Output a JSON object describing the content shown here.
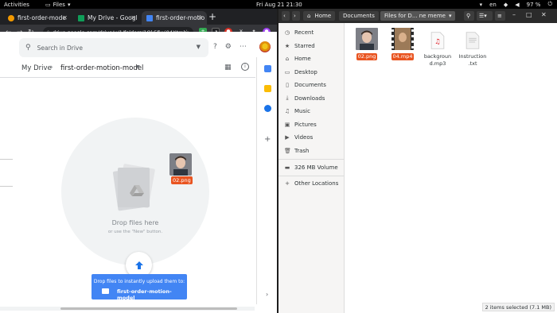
{
  "topbar": {
    "activities": "Activities",
    "app_menu": "Files",
    "clock": "Fri Aug 21  21:30",
    "lang": "en",
    "battery": "97 %"
  },
  "chrome": {
    "tabs": [
      {
        "title": "first-order-mode",
        "fav_color": "#f29900"
      },
      {
        "title": "My Drive - Googl",
        "fav_color": "#0f9d58"
      },
      {
        "title": "first-order-motio",
        "fav_color": "#4285f4"
      }
    ],
    "url": "drive.google.com/drive/u/1/folders/1Qk5fiwj04Xtmk..."
  },
  "drive": {
    "search_placeholder": "Search in Drive",
    "breadcrumb_root": "My Drive",
    "breadcrumb_folder": "first-order-motion-model",
    "drop_title": "Drop files here",
    "drop_sub": "or use the \"New\" button.",
    "toast_line1": "Drop files to instantly upload them to:",
    "toast_folder": "first-order-motion-model",
    "drag_label": "02.png"
  },
  "files": {
    "breadcrumbs": [
      "Home",
      "Documents",
      "Files for D... ne meme"
    ],
    "sidebar": [
      {
        "label": "Recent",
        "icon": "clock-icon"
      },
      {
        "label": "Starred",
        "icon": "star-icon"
      },
      {
        "label": "Home",
        "icon": "home-icon"
      },
      {
        "label": "Desktop",
        "icon": "desktop-icon"
      },
      {
        "label": "Documents",
        "icon": "document-icon"
      },
      {
        "label": "Downloads",
        "icon": "download-icon"
      },
      {
        "label": "Music",
        "icon": "music-icon"
      },
      {
        "label": "Pictures",
        "icon": "pictures-icon"
      },
      {
        "label": "Videos",
        "icon": "video-icon"
      },
      {
        "label": "Trash",
        "icon": "trash-icon"
      }
    ],
    "volume": "326 MB Volume",
    "other": "Other Locations",
    "items": [
      {
        "name": "02.png",
        "selected": true
      },
      {
        "name": "04.mp4",
        "selected": true
      },
      {
        "name": "background.mp3",
        "selected": false
      },
      {
        "name": "Instructions.txt",
        "selected": false
      }
    ],
    "item_lines": [
      [
        "02.png"
      ],
      [
        "04.mp4"
      ],
      [
        "backgroun",
        "d.mp3"
      ],
      [
        "Instruction",
        ".txt"
      ]
    ],
    "status": "2 items selected  (7.1 MB)"
  }
}
